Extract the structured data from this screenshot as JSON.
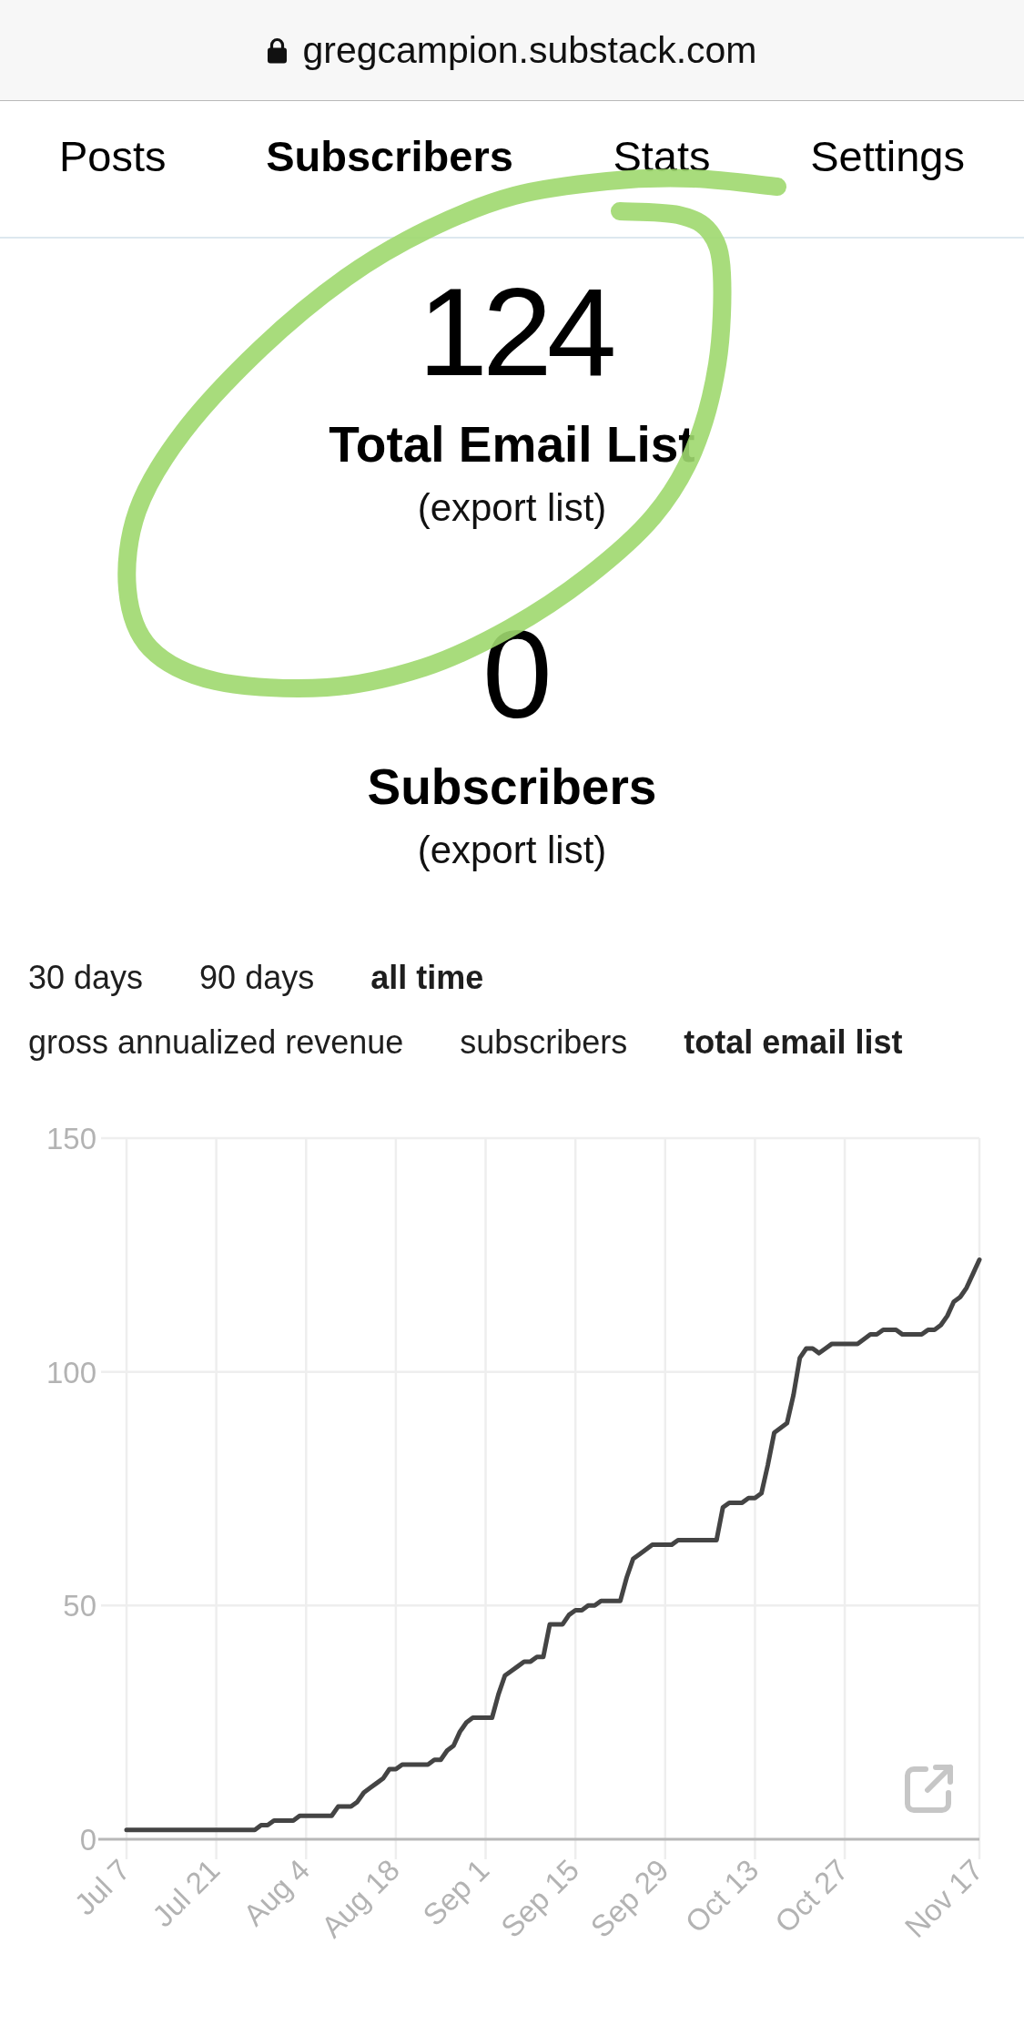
{
  "browser": {
    "url": "gregcampion.substack.com"
  },
  "nav_tabs": [
    {
      "label": "Posts",
      "selected": false
    },
    {
      "label": "Subscribers",
      "selected": true
    },
    {
      "label": "Stats",
      "selected": false
    },
    {
      "label": "Settings",
      "selected": false
    }
  ],
  "stats": [
    {
      "value": "124",
      "label": "Total Email List",
      "link": "(export list)"
    },
    {
      "value": "0",
      "label": "Subscribers",
      "link": "(export list)"
    }
  ],
  "range_filters": [
    {
      "label": "30 days",
      "selected": false
    },
    {
      "label": "90 days",
      "selected": false
    },
    {
      "label": "all time",
      "selected": true
    }
  ],
  "metric_filters": [
    {
      "label": "gross annualized revenue",
      "selected": false
    },
    {
      "label": "subscribers",
      "selected": false
    },
    {
      "label": "total email list",
      "selected": true
    }
  ],
  "chart": {
    "chart_data": {
      "type": "line",
      "categories": [
        "Jul 7",
        null,
        null,
        null,
        null,
        null,
        null,
        null,
        null,
        null,
        null,
        null,
        null,
        null,
        "Jul 21",
        null,
        null,
        null,
        null,
        null,
        null,
        null,
        null,
        null,
        null,
        null,
        null,
        null,
        "Aug 4",
        null,
        null,
        null,
        null,
        null,
        null,
        null,
        null,
        null,
        null,
        null,
        null,
        null,
        "Aug 18",
        null,
        null,
        null,
        null,
        null,
        null,
        null,
        null,
        null,
        null,
        null,
        null,
        null,
        "Sep 1",
        null,
        null,
        null,
        null,
        null,
        null,
        null,
        null,
        null,
        null,
        null,
        null,
        null,
        "Sep 15",
        null,
        null,
        null,
        null,
        null,
        null,
        null,
        null,
        null,
        null,
        null,
        null,
        null,
        "Sep 29",
        null,
        null,
        null,
        null,
        null,
        null,
        null,
        null,
        null,
        null,
        null,
        null,
        null,
        "Oct 13",
        null,
        null,
        null,
        null,
        null,
        null,
        null,
        null,
        null,
        null,
        null,
        null,
        null,
        "Oct 27",
        null,
        null,
        null,
        null,
        null,
        null,
        null,
        null,
        null,
        null,
        null,
        null,
        null,
        null,
        null,
        null,
        null,
        null,
        null,
        null,
        "Nov 17"
      ],
      "values": [
        2,
        2,
        2,
        2,
        2,
        2,
        2,
        2,
        2,
        2,
        2,
        2,
        2,
        2,
        2,
        2,
        2,
        2,
        2,
        2,
        2,
        3,
        3,
        4,
        4,
        4,
        4,
        5,
        5,
        5,
        5,
        5,
        5,
        7,
        7,
        7,
        8,
        10,
        11,
        12,
        13,
        15,
        15,
        16,
        16,
        16,
        16,
        16,
        17,
        17,
        19,
        20,
        23,
        25,
        26,
        26,
        26,
        26,
        31,
        35,
        36,
        37,
        38,
        38,
        39,
        39,
        46,
        46,
        46,
        48,
        49,
        49,
        50,
        50,
        51,
        51,
        51,
        51,
        56,
        60,
        61,
        62,
        63,
        63,
        63,
        63,
        64,
        64,
        64,
        64,
        64,
        64,
        64,
        71,
        72,
        72,
        72,
        73,
        73,
        74,
        80,
        87,
        88,
        89,
        95,
        103,
        105,
        105,
        104,
        105,
        106,
        106,
        106,
        106,
        106,
        107,
        108,
        108,
        109,
        109,
        109,
        108,
        108,
        108,
        108,
        109,
        109,
        110,
        112,
        115,
        116,
        118,
        121,
        124
      ],
      "ylim": [
        0,
        150
      ],
      "yticks": [
        0,
        50,
        100,
        150
      ]
    }
  }
}
